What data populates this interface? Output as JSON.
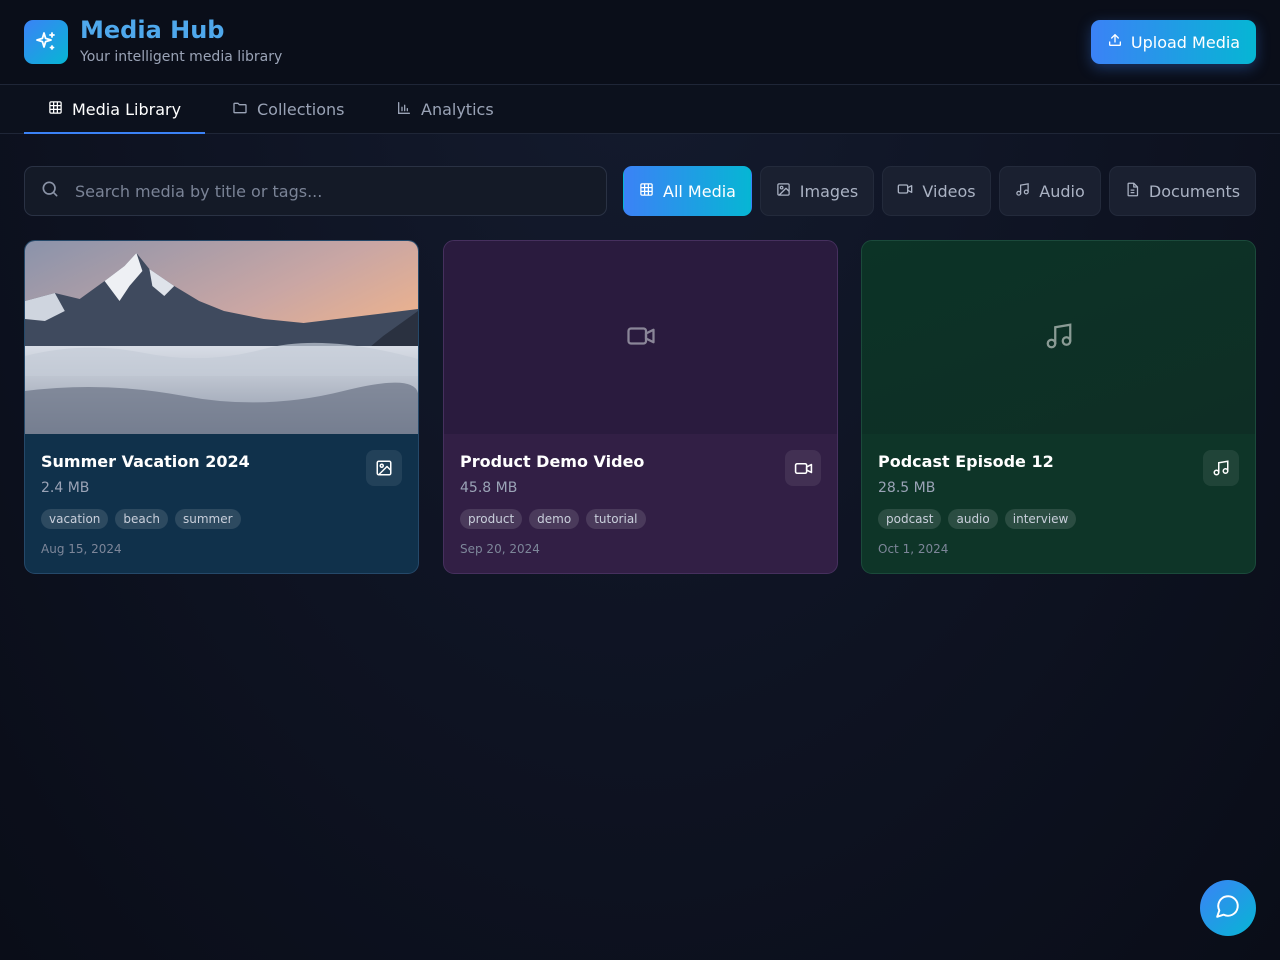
{
  "app": {
    "title": "Media Hub",
    "subtitle": "Your intelligent media library",
    "upload_label": "Upload Media"
  },
  "tabs": [
    {
      "label": "Media Library",
      "icon": "grid-icon",
      "active": true
    },
    {
      "label": "Collections",
      "icon": "folder-icon",
      "active": false
    },
    {
      "label": "Analytics",
      "icon": "bar-chart-icon",
      "active": false
    }
  ],
  "search": {
    "placeholder": "Search media by title or tags..."
  },
  "filters": [
    {
      "label": "All Media",
      "icon": "grid-icon",
      "active": true
    },
    {
      "label": "Images",
      "icon": "image-icon",
      "active": false
    },
    {
      "label": "Videos",
      "icon": "video-icon",
      "active": false
    },
    {
      "label": "Audio",
      "icon": "music-icon",
      "active": false
    },
    {
      "label": "Documents",
      "icon": "document-icon",
      "active": false
    }
  ],
  "media": [
    {
      "title": "Summer Vacation 2024",
      "size": "2.4 MB",
      "type": "image",
      "type_icon": "image-icon",
      "tags": [
        "vacation",
        "beach",
        "summer"
      ],
      "date": "Aug 15, 2024"
    },
    {
      "title": "Product Demo Video",
      "size": "45.8 MB",
      "type": "video",
      "type_icon": "video-icon",
      "tags": [
        "product",
        "demo",
        "tutorial"
      ],
      "date": "Sep 20, 2024"
    },
    {
      "title": "Podcast Episode 12",
      "size": "28.5 MB",
      "type": "audio",
      "type_icon": "music-icon",
      "tags": [
        "podcast",
        "audio",
        "interview"
      ],
      "date": "Oct 1, 2024"
    }
  ],
  "colors": {
    "accent_start": "#3b82f6",
    "accent_end": "#06b6d4",
    "title": "#4fa8ec"
  }
}
